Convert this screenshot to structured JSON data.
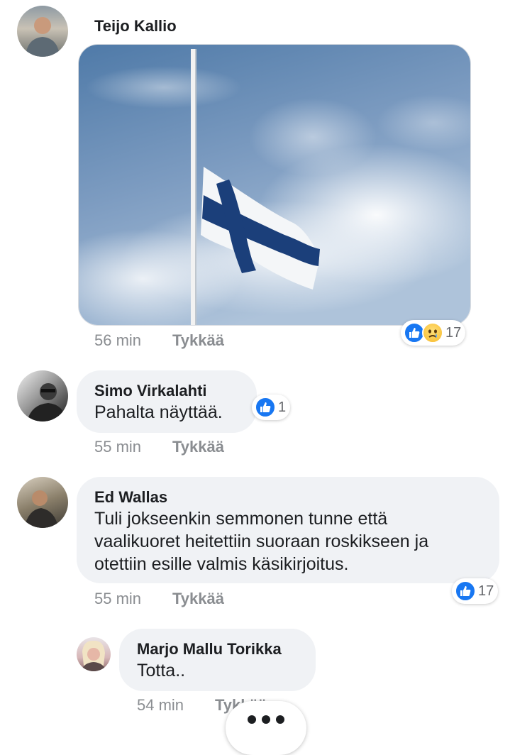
{
  "comments": [
    {
      "author": "Teijo Kallio",
      "time": "56 min",
      "like_label": "Tykkää",
      "reaction_count": "17",
      "reactions": [
        "like-icon",
        "sad-icon"
      ],
      "image": "finnish-flag-half-mast"
    },
    {
      "author": "Simo Virkalahti",
      "text": "Pahalta näyttää.",
      "time": "55 min",
      "like_label": "Tykkää",
      "reaction_count": "1",
      "reactions": [
        "like-icon"
      ]
    },
    {
      "author": "Ed Wallas",
      "text_lines": [
        "Tuli jokseenkin semmonen tunne että",
        "vaalikuoret heitettiin suoraan roskikseen ja",
        "otettiin esille valmis käsikirjoitus."
      ],
      "time": "55 min",
      "like_label": "Tykkää",
      "reaction_count": "17",
      "reactions": [
        "like-icon"
      ]
    },
    {
      "author": "Marjo Mallu Torikka",
      "text": "Totta..",
      "time": "54 min",
      "like_label": "Tykkää",
      "reply": true
    }
  ],
  "more_button_icon": "more-dots-icon",
  "colors": {
    "accent": "#1877f2",
    "bubble": "#f0f2f5",
    "meta": "#8a8d91",
    "sad": "#f7b928"
  }
}
